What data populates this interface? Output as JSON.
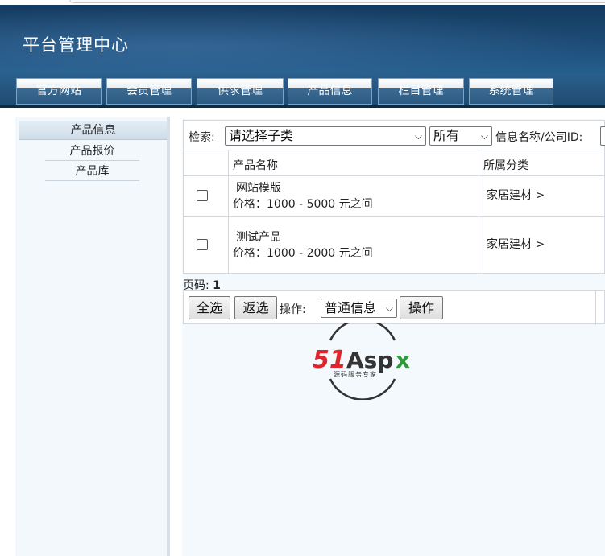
{
  "app": {
    "title": "平台管理中心"
  },
  "nav": {
    "items": [
      "官方网站",
      "会员管理",
      "供求管理",
      "产品信息",
      "栏目管理",
      "系统管理"
    ]
  },
  "sidebar": {
    "items": [
      {
        "label": "产品信息",
        "active": true
      },
      {
        "label": "产品报价",
        "active": false
      },
      {
        "label": "产品库",
        "active": false
      }
    ]
  },
  "search": {
    "label": "检索:",
    "category_select": "请选择子类",
    "scope_select": "所有",
    "field_label": "信息名称/公司ID:"
  },
  "table": {
    "headers": [
      "产品名称",
      "所属分类"
    ],
    "rows": [
      {
        "name": "网站模版",
        "price": "价格：1000 - 5000 元之间",
        "category": "家居建材 >"
      },
      {
        "name": "测试产品",
        "price": "价格：1000 - 2000 元之间",
        "category": "家居建材 >"
      }
    ]
  },
  "pager": {
    "label": "页码:",
    "page": "1"
  },
  "actions": {
    "select_all": "全选",
    "invert": "返选",
    "op_label": "操作:",
    "op_select": "普通信息",
    "op_button": "操作"
  },
  "logo": {
    "brand": "51Aspx",
    "tagline": "源码服务专家"
  },
  "colors": {
    "header_dark": "#143a5e",
    "header_light": "#2f6c9b",
    "logo_red": "#e1232b",
    "logo_green": "#2e9a3a"
  }
}
